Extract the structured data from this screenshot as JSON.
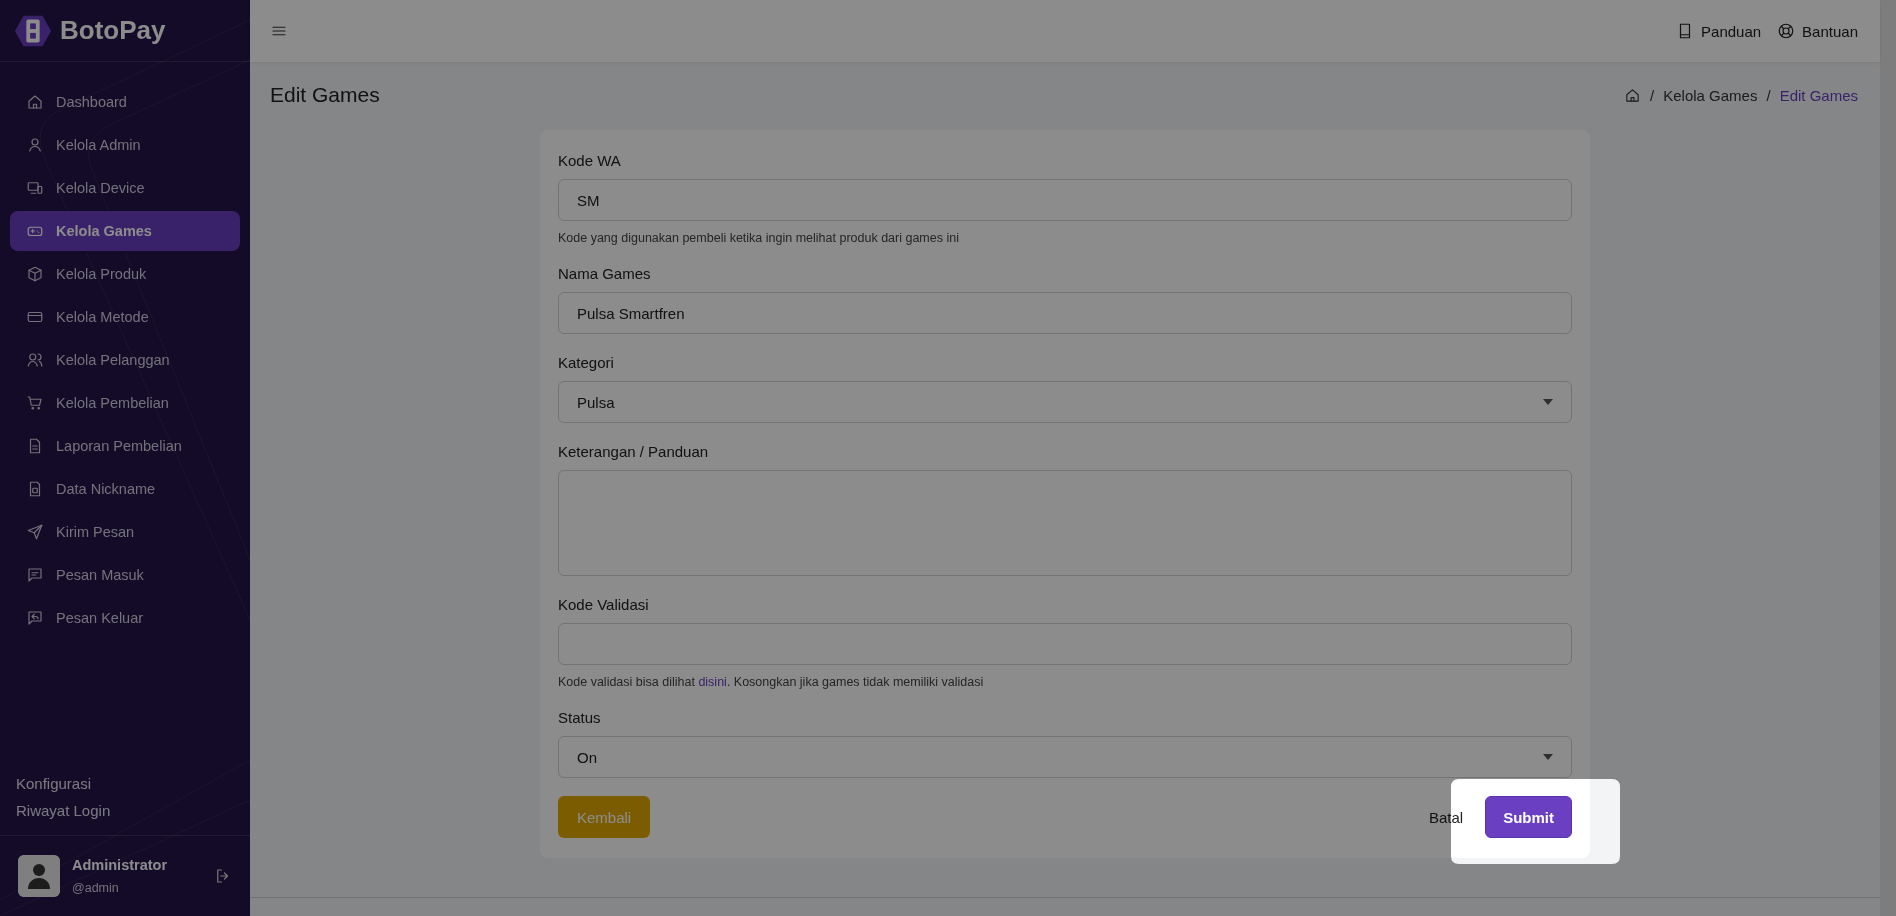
{
  "brand": {
    "name": "BotoPay"
  },
  "sidebar": {
    "items": [
      {
        "label": "Dashboard",
        "selected": false
      },
      {
        "label": "Kelola Admin",
        "selected": false
      },
      {
        "label": "Kelola Device",
        "selected": false
      },
      {
        "label": "Kelola Games",
        "selected": true
      },
      {
        "label": "Kelola Produk",
        "selected": false
      },
      {
        "label": "Kelola Metode",
        "selected": false
      },
      {
        "label": "Kelola Pelanggan",
        "selected": false
      },
      {
        "label": "Kelola Pembelian",
        "selected": false
      },
      {
        "label": "Laporan Pembelian",
        "selected": false
      },
      {
        "label": "Data Nickname",
        "selected": false
      },
      {
        "label": "Kirim Pesan",
        "selected": false
      },
      {
        "label": "Pesan Masuk",
        "selected": false
      },
      {
        "label": "Pesan Keluar",
        "selected": false
      }
    ],
    "links": [
      "Konfigurasi",
      "Riwayat Login"
    ],
    "user": {
      "name": "Administrator",
      "handle": "@admin"
    }
  },
  "topbar": {
    "links": [
      "Panduan",
      "Bantuan"
    ]
  },
  "page": {
    "title": "Edit Games",
    "breadcrumb": [
      {
        "separator": "/",
        "label": "Kelola Games"
      },
      {
        "separator": "/",
        "label": "Edit Games"
      }
    ]
  },
  "form": {
    "fields": [
      {
        "kind": "input",
        "label": "Kode WA",
        "value": "SM",
        "hint": {
          "text": "Kode yang digunakan pembeli ketika ingin melihat produk dari games ini"
        }
      },
      {
        "kind": "input",
        "label": "Nama Games",
        "value": "Pulsa Smartfren"
      },
      {
        "kind": "select",
        "label": "Kategori",
        "value": "Pulsa"
      },
      {
        "kind": "textarea",
        "label": "Keterangan / Panduan"
      },
      {
        "kind": "input",
        "label": "Kode Validasi",
        "hint": {
          "text": "Kode validasi bisa dilihat ",
          "link": "disini",
          "after": ". Kosongkan jika games tidak memiliki validasi"
        }
      },
      {
        "kind": "select",
        "label": "Status",
        "value": "On"
      }
    ],
    "back_button": "Kembali",
    "cancel_link": "Batal",
    "submit_button": "Submit"
  }
}
